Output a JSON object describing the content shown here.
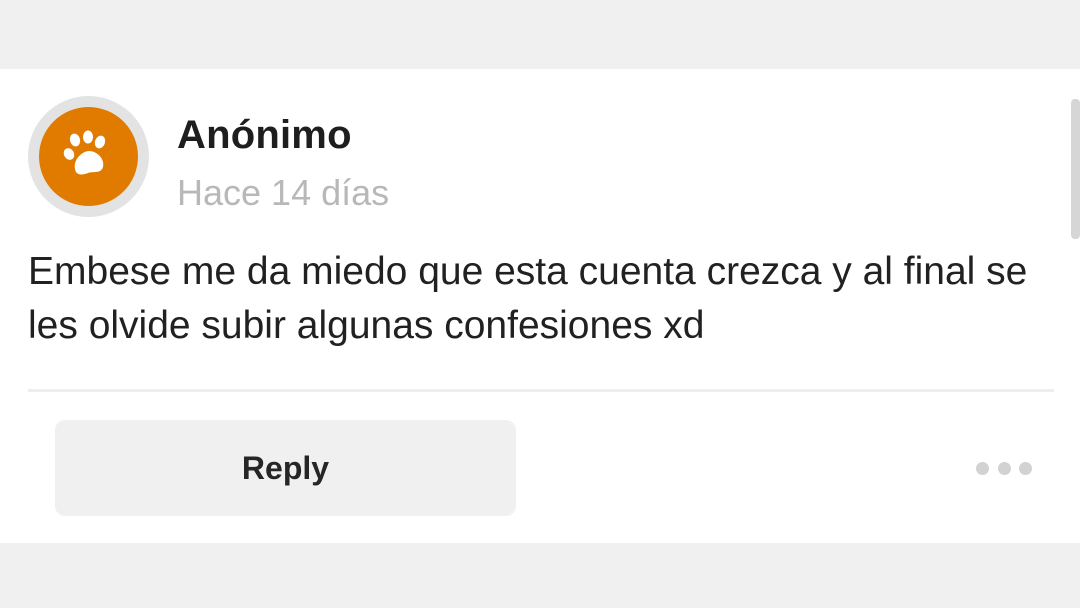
{
  "post": {
    "author": "Anónimo",
    "timestamp": "Hace 14 días",
    "message": "Embese me da miedo que esta cuenta crezca y al final se les olvide subir algunas confesiones xd",
    "avatar_icon": "paw-icon",
    "avatar_color": "#e07b00"
  },
  "actions": {
    "reply_label": "Reply",
    "more_icon": "more-horizontal-icon"
  }
}
